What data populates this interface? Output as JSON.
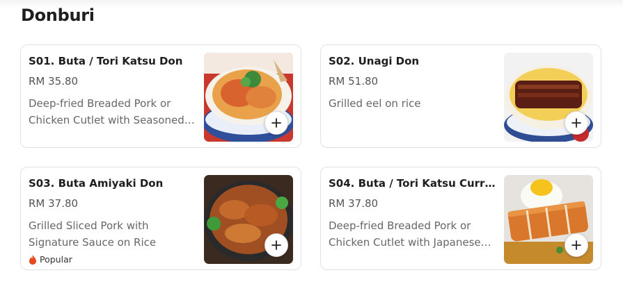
{
  "section": {
    "title": "Donburi"
  },
  "items": [
    {
      "name": "S01. Buta / Tori Katsu Don",
      "price": "RM 35.80",
      "description": "Deep-fried Breaded Pork or Chicken Cutlet with Seasoned…"
    },
    {
      "name": "S02. Unagi Don",
      "price": "RM 51.80",
      "description": "Grilled eel on rice"
    },
    {
      "name": "S03. Buta Amiyaki Don",
      "price": "RM 37.80",
      "description": "Grilled Sliced Pork with Signature Sauce on Rice",
      "badge": "Popular"
    },
    {
      "name": "S04. Buta / Tori Katsu Curry …",
      "price": "RM 37.80",
      "description": "Deep-fried Breaded Pork or Chicken Cutlet with Japanese…"
    }
  ],
  "icons": {
    "add": "plus-icon",
    "popular": "flame-icon"
  },
  "colors": {
    "popular_flame": "#e8481c",
    "card_border": "#e2e2e2"
  }
}
